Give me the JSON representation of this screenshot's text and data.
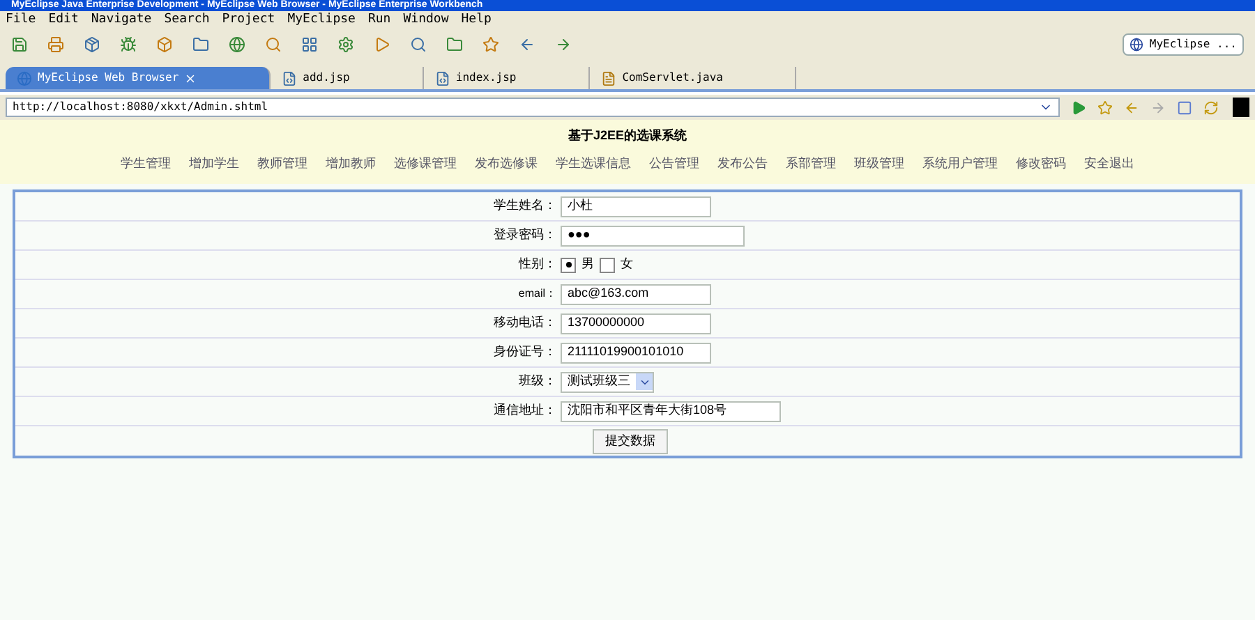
{
  "window": {
    "title": "MyEclipse Java Enterprise Development - MyEclipse Web Browser - MyEclipse Enterprise Workbench"
  },
  "menu": [
    "File",
    "Edit",
    "Navigate",
    "Search",
    "Project",
    "MyEclipse",
    "Run",
    "Window",
    "Help"
  ],
  "perspective": {
    "label": "MyEclipse ..."
  },
  "editor_tabs": [
    {
      "label": "MyEclipse Web Browser",
      "kind": "browser",
      "selected": true
    },
    {
      "label": "add.jsp",
      "kind": "jsp",
      "selected": false
    },
    {
      "label": "index.jsp",
      "kind": "jsp",
      "selected": false
    },
    {
      "label": "ComServlet.java",
      "kind": "java",
      "selected": false
    }
  ],
  "address_bar": {
    "value": "http://localhost:8080/xkxt/Admin.shtml"
  },
  "page": {
    "title": "基于J2EE的选课系统",
    "nav": [
      "学生管理",
      "增加学生",
      "教师管理",
      "增加教师",
      "选修课管理",
      "发布选修课",
      "学生选课信息",
      "公告管理",
      "发布公告",
      "系部管理",
      "班级管理",
      "系统用户管理",
      "修改密码",
      "安全退出"
    ],
    "form": {
      "fields": [
        {
          "label": "学生姓名：",
          "kind": "text",
          "value": "小杜"
        },
        {
          "label": "登录密码：",
          "kind": "password",
          "value": "●●●"
        },
        {
          "label": "性别：",
          "kind": "radio",
          "options": [
            {
              "label": "男",
              "selected": true
            },
            {
              "label": "女",
              "selected": false
            }
          ]
        },
        {
          "label": "email：",
          "kind": "text",
          "value": "abc@163.com"
        },
        {
          "label": "移动电话：",
          "kind": "text",
          "value": "13700000000"
        },
        {
          "label": "身份证号：",
          "kind": "text",
          "value": "21111019900101010"
        },
        {
          "label": "班级：",
          "kind": "select",
          "value": "测试班级三"
        },
        {
          "label": "通信地址：",
          "kind": "text",
          "value": "沈阳市和平区青年大街108号"
        }
      ],
      "submit": "提交数据"
    }
  }
}
